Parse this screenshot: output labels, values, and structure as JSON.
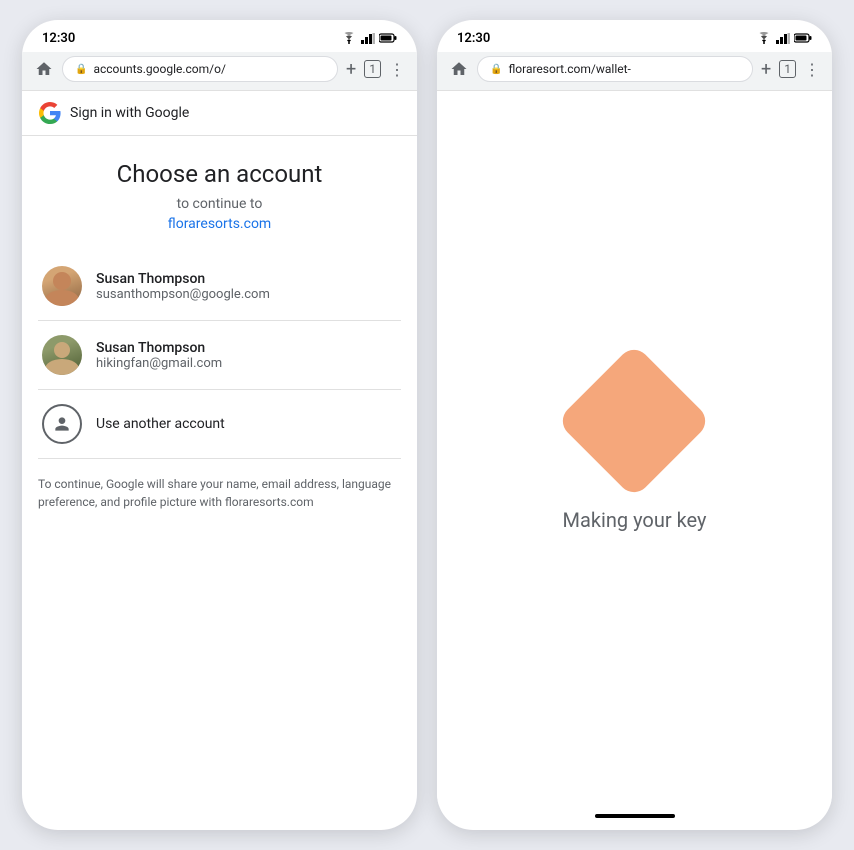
{
  "left_phone": {
    "status_bar": {
      "time": "12:30",
      "wifi": "▲",
      "signal": "▲",
      "battery": "🔋"
    },
    "browser": {
      "address": "accounts.google.com/o/",
      "new_tab_label": "+",
      "tabs_label": "1",
      "more_label": "⋮",
      "home_label": "⌂"
    },
    "google_bar": {
      "label": "Sign in with Google"
    },
    "chooser": {
      "title": "Choose an account",
      "subtitle": "to continue to",
      "link_text": "floraresorts.com",
      "accounts": [
        {
          "name": "Susan Thompson",
          "email": "susanthompson@google.com"
        },
        {
          "name": "Susan Thompson",
          "email": "hikingfan@gmail.com"
        }
      ],
      "another_account_label": "Use another account"
    },
    "privacy": {
      "text": "To continue, Google will share your name, email address, language preference, and profile picture with floraresorts.com"
    }
  },
  "right_phone": {
    "status_bar": {
      "time": "12:30"
    },
    "browser": {
      "address": "floraresort.com/wallet-",
      "new_tab_label": "+",
      "tabs_label": "1",
      "more_label": "⋮",
      "home_label": "⌂"
    },
    "content": {
      "diamond_color": "#f5a77b",
      "label": "Making your key"
    }
  },
  "icons": {
    "wifi": "wifi-icon",
    "signal": "signal-icon",
    "battery": "battery-icon",
    "lock": "lock-icon",
    "home": "home-icon",
    "add_tab": "add-tab-icon",
    "tab_count": "tab-count-icon",
    "more": "more-options-icon",
    "google_g": "google-logo-icon",
    "account_circle": "account-circle-icon",
    "diamond": "diamond-icon",
    "home_indicator": "home-indicator-bar"
  }
}
